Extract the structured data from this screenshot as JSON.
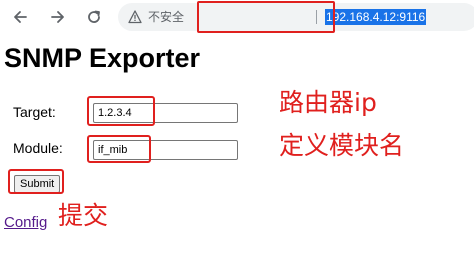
{
  "browser": {
    "security_label": "不安全",
    "url": "192.168.4.12:9116"
  },
  "page": {
    "title": "SNMP Exporter",
    "target_label": "Target:",
    "target_value": "1.2.3.4",
    "module_label": "Module:",
    "module_value": "if_mib",
    "submit_label": "Submit",
    "config_link": "Config"
  },
  "annotations": {
    "router_ip": "路由器ip",
    "module_name": "定义模块名",
    "submit": "提交",
    "color": "#e0201e"
  },
  "icons": [
    "back-arrow-icon",
    "forward-arrow-icon",
    "reload-icon",
    "warning-icon"
  ]
}
